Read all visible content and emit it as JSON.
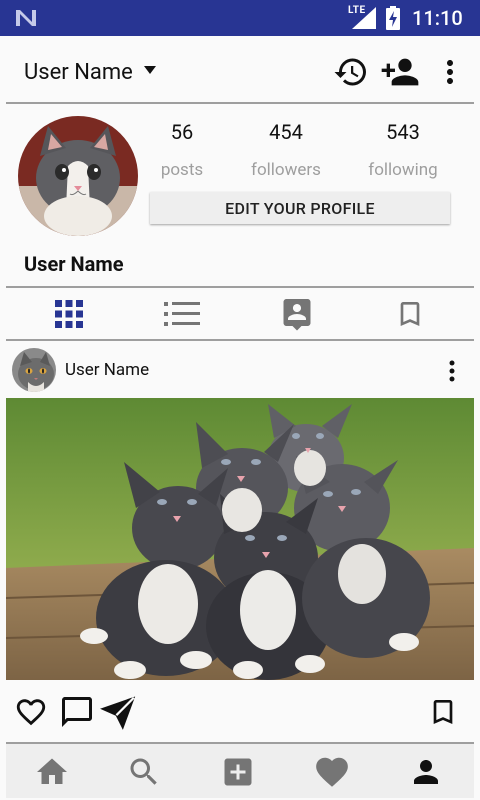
{
  "status_bar": {
    "network": "LTE",
    "time": "11:10"
  },
  "top_bar": {
    "username": "User Name"
  },
  "profile": {
    "stats": [
      {
        "value": "56",
        "label": "posts"
      },
      {
        "value": "454",
        "label": "followers"
      },
      {
        "value": "543",
        "label": "following"
      }
    ],
    "edit_button": "EDIT YOUR PROFILE",
    "display_name": "User Name"
  },
  "tabs": [
    {
      "icon": "grid-icon",
      "active": true
    },
    {
      "icon": "list-icon",
      "active": false
    },
    {
      "icon": "tagged-icon",
      "active": false
    },
    {
      "icon": "bookmark-icon",
      "active": false
    }
  ],
  "post": {
    "username": "User Name"
  },
  "bottom_nav": [
    {
      "icon": "home-icon",
      "active": false
    },
    {
      "icon": "search-icon",
      "active": false
    },
    {
      "icon": "add-icon",
      "active": false
    },
    {
      "icon": "heart-icon",
      "active": false
    },
    {
      "icon": "profile-icon",
      "active": true
    }
  ],
  "colors": {
    "status_bar": "#283593",
    "accent": "#283593",
    "inactive_icon": "#757575",
    "divider": "#9e9e9e"
  }
}
